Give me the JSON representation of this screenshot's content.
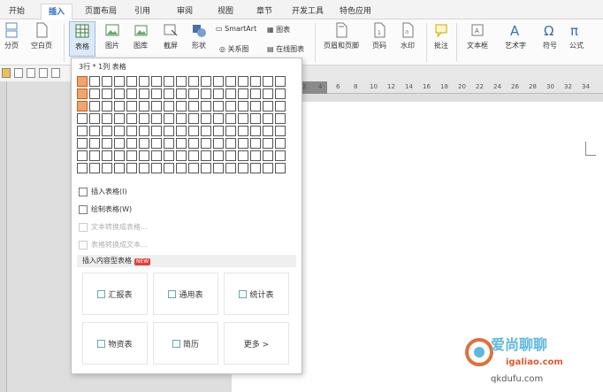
{
  "tabs": [
    "开始",
    "插入",
    "页面布局",
    "引用",
    "审阅",
    "视图",
    "章节",
    "开发工具",
    "特色应用"
  ],
  "active_tab": "插入",
  "ribbon": {
    "page_label": "分页",
    "blank_page_label": "空白页",
    "table_label": "表格",
    "picture_label": "图片",
    "gallery_label": "图库",
    "screenshot_label": "截屏",
    "shape_label": "形状",
    "smartart_label": "SmartArt",
    "chart_label": "图表",
    "relation_label": "关系图",
    "online_chart_label": "在线图表",
    "header_footer_label": "页眉和页脚",
    "page_number_label": "页码",
    "watermark_label": "水印",
    "comment_label": "批注",
    "textbox_label": "文本框",
    "wordart_label": "艺术字",
    "symbol_label": "符号",
    "formula_label": "公式"
  },
  "ruler_numbers": [
    "2",
    "4",
    "6",
    "8",
    "10",
    "12",
    "14",
    "16",
    "18",
    "20",
    "22",
    "24",
    "26",
    "28",
    "30",
    "32",
    "34"
  ],
  "dropdown": {
    "header": "3行 * 1列 表格",
    "grid_rows": 8,
    "grid_cols": 17,
    "selected_rows": 3,
    "selected_cols": 1,
    "items": [
      {
        "label": "插入表格(I)",
        "disabled": false
      },
      {
        "label": "绘制表格(W)",
        "disabled": false
      },
      {
        "label": "文本转换成表格...",
        "disabled": true
      },
      {
        "label": "表格转换成文本...",
        "disabled": true
      }
    ],
    "section_title": "插入内容型表格",
    "new_badge": "NEW",
    "cards": [
      "汇报表",
      "通用表",
      "统计表",
      "物资表",
      "简历",
      "更多 >"
    ]
  },
  "watermark": {
    "line1": "爱尚",
    "line2": "聊聊",
    "line3": "igaliao.com",
    "line4": "qkdufu.com"
  },
  "colors": {
    "accent": "#2a6cc0",
    "grid_selected": "#f3a46c",
    "badge": "#e0403a"
  }
}
